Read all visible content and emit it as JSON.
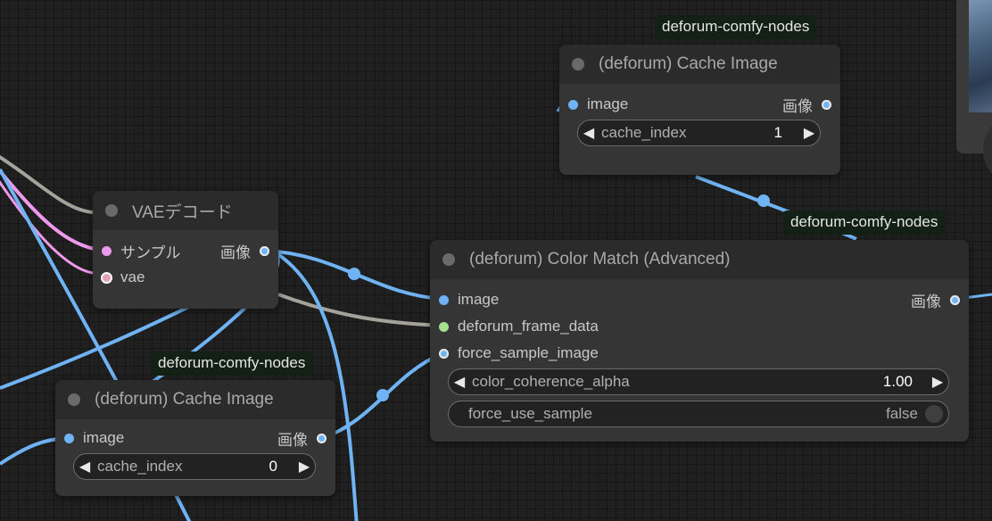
{
  "colors": {
    "canvas_bg": "#202020",
    "node_body": "#353535",
    "node_title": "#2b2b2b",
    "badge_bg": "#122015",
    "image_slot": "#6fb3f4",
    "latent_slot": "#ee99ec",
    "vae_slot": "#e6a0b4",
    "frame_data_slot": "#a6e08c",
    "wire_gray": "#a3a39a"
  },
  "nodes": {
    "vae_decode": {
      "title": "VAEデコード",
      "inputs": [
        "サンプル",
        "vae"
      ],
      "output": "画像"
    },
    "cache_top": {
      "badge": "deforum-comfy-nodes",
      "title": "(deforum) Cache Image",
      "input": "image",
      "output": "画像",
      "widget": {
        "label": "cache_index",
        "value": "1"
      }
    },
    "color_match": {
      "badge": "deforum-comfy-nodes",
      "title": "(deforum) Color Match (Advanced)",
      "inputs": [
        "image",
        "deforum_frame_data",
        "force_sample_image"
      ],
      "output": "画像",
      "widgets": [
        {
          "label": "color_coherence_alpha",
          "value": "1.00"
        },
        {
          "label": "force_use_sample",
          "value": "false"
        }
      ]
    },
    "cache_bottom": {
      "badge": "deforum-comfy-nodes",
      "title": "(deforum) Cache Image",
      "input": "image",
      "output": "画像",
      "widget": {
        "label": "cache_index",
        "value": "0"
      }
    }
  },
  "icons": {
    "decrement": "◀",
    "increment": "▶"
  }
}
